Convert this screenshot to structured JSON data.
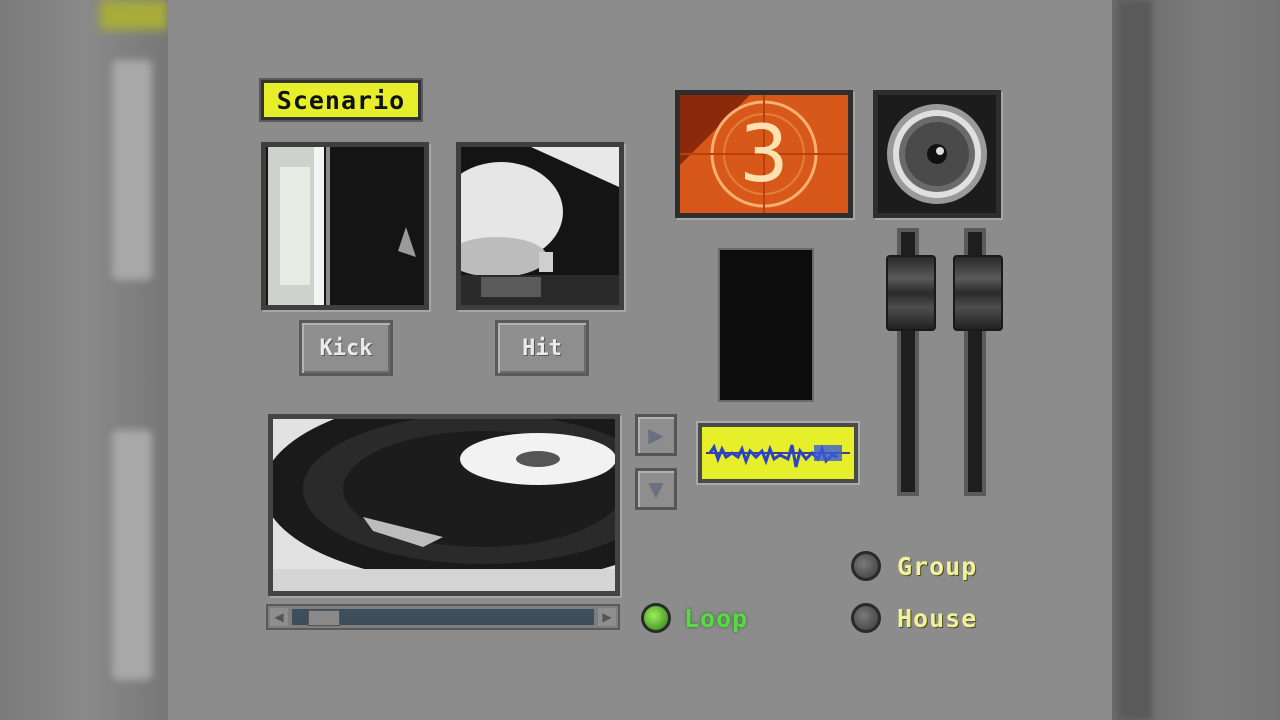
{
  "scenario": {
    "label": "Scenario"
  },
  "samples": [
    {
      "label": "Kick"
    },
    {
      "label": "Hit"
    }
  ],
  "countdown": {
    "number": "3"
  },
  "transport": {
    "play_icon": "play-right-icon",
    "down_icon": "arrow-down-icon"
  },
  "scrub": {
    "position": 0.05
  },
  "toggles": {
    "loop": {
      "label": "Loop",
      "on": true
    },
    "group": {
      "label": "Group",
      "on": false
    },
    "house": {
      "label": "House",
      "on": false
    }
  },
  "faders": [
    {
      "level": 0.85
    },
    {
      "level": 0.85
    }
  ],
  "colors": {
    "accent_yellow": "#e6ef2a",
    "loop_green": "#5ad84a",
    "label_yellow": "#f2f09a"
  }
}
